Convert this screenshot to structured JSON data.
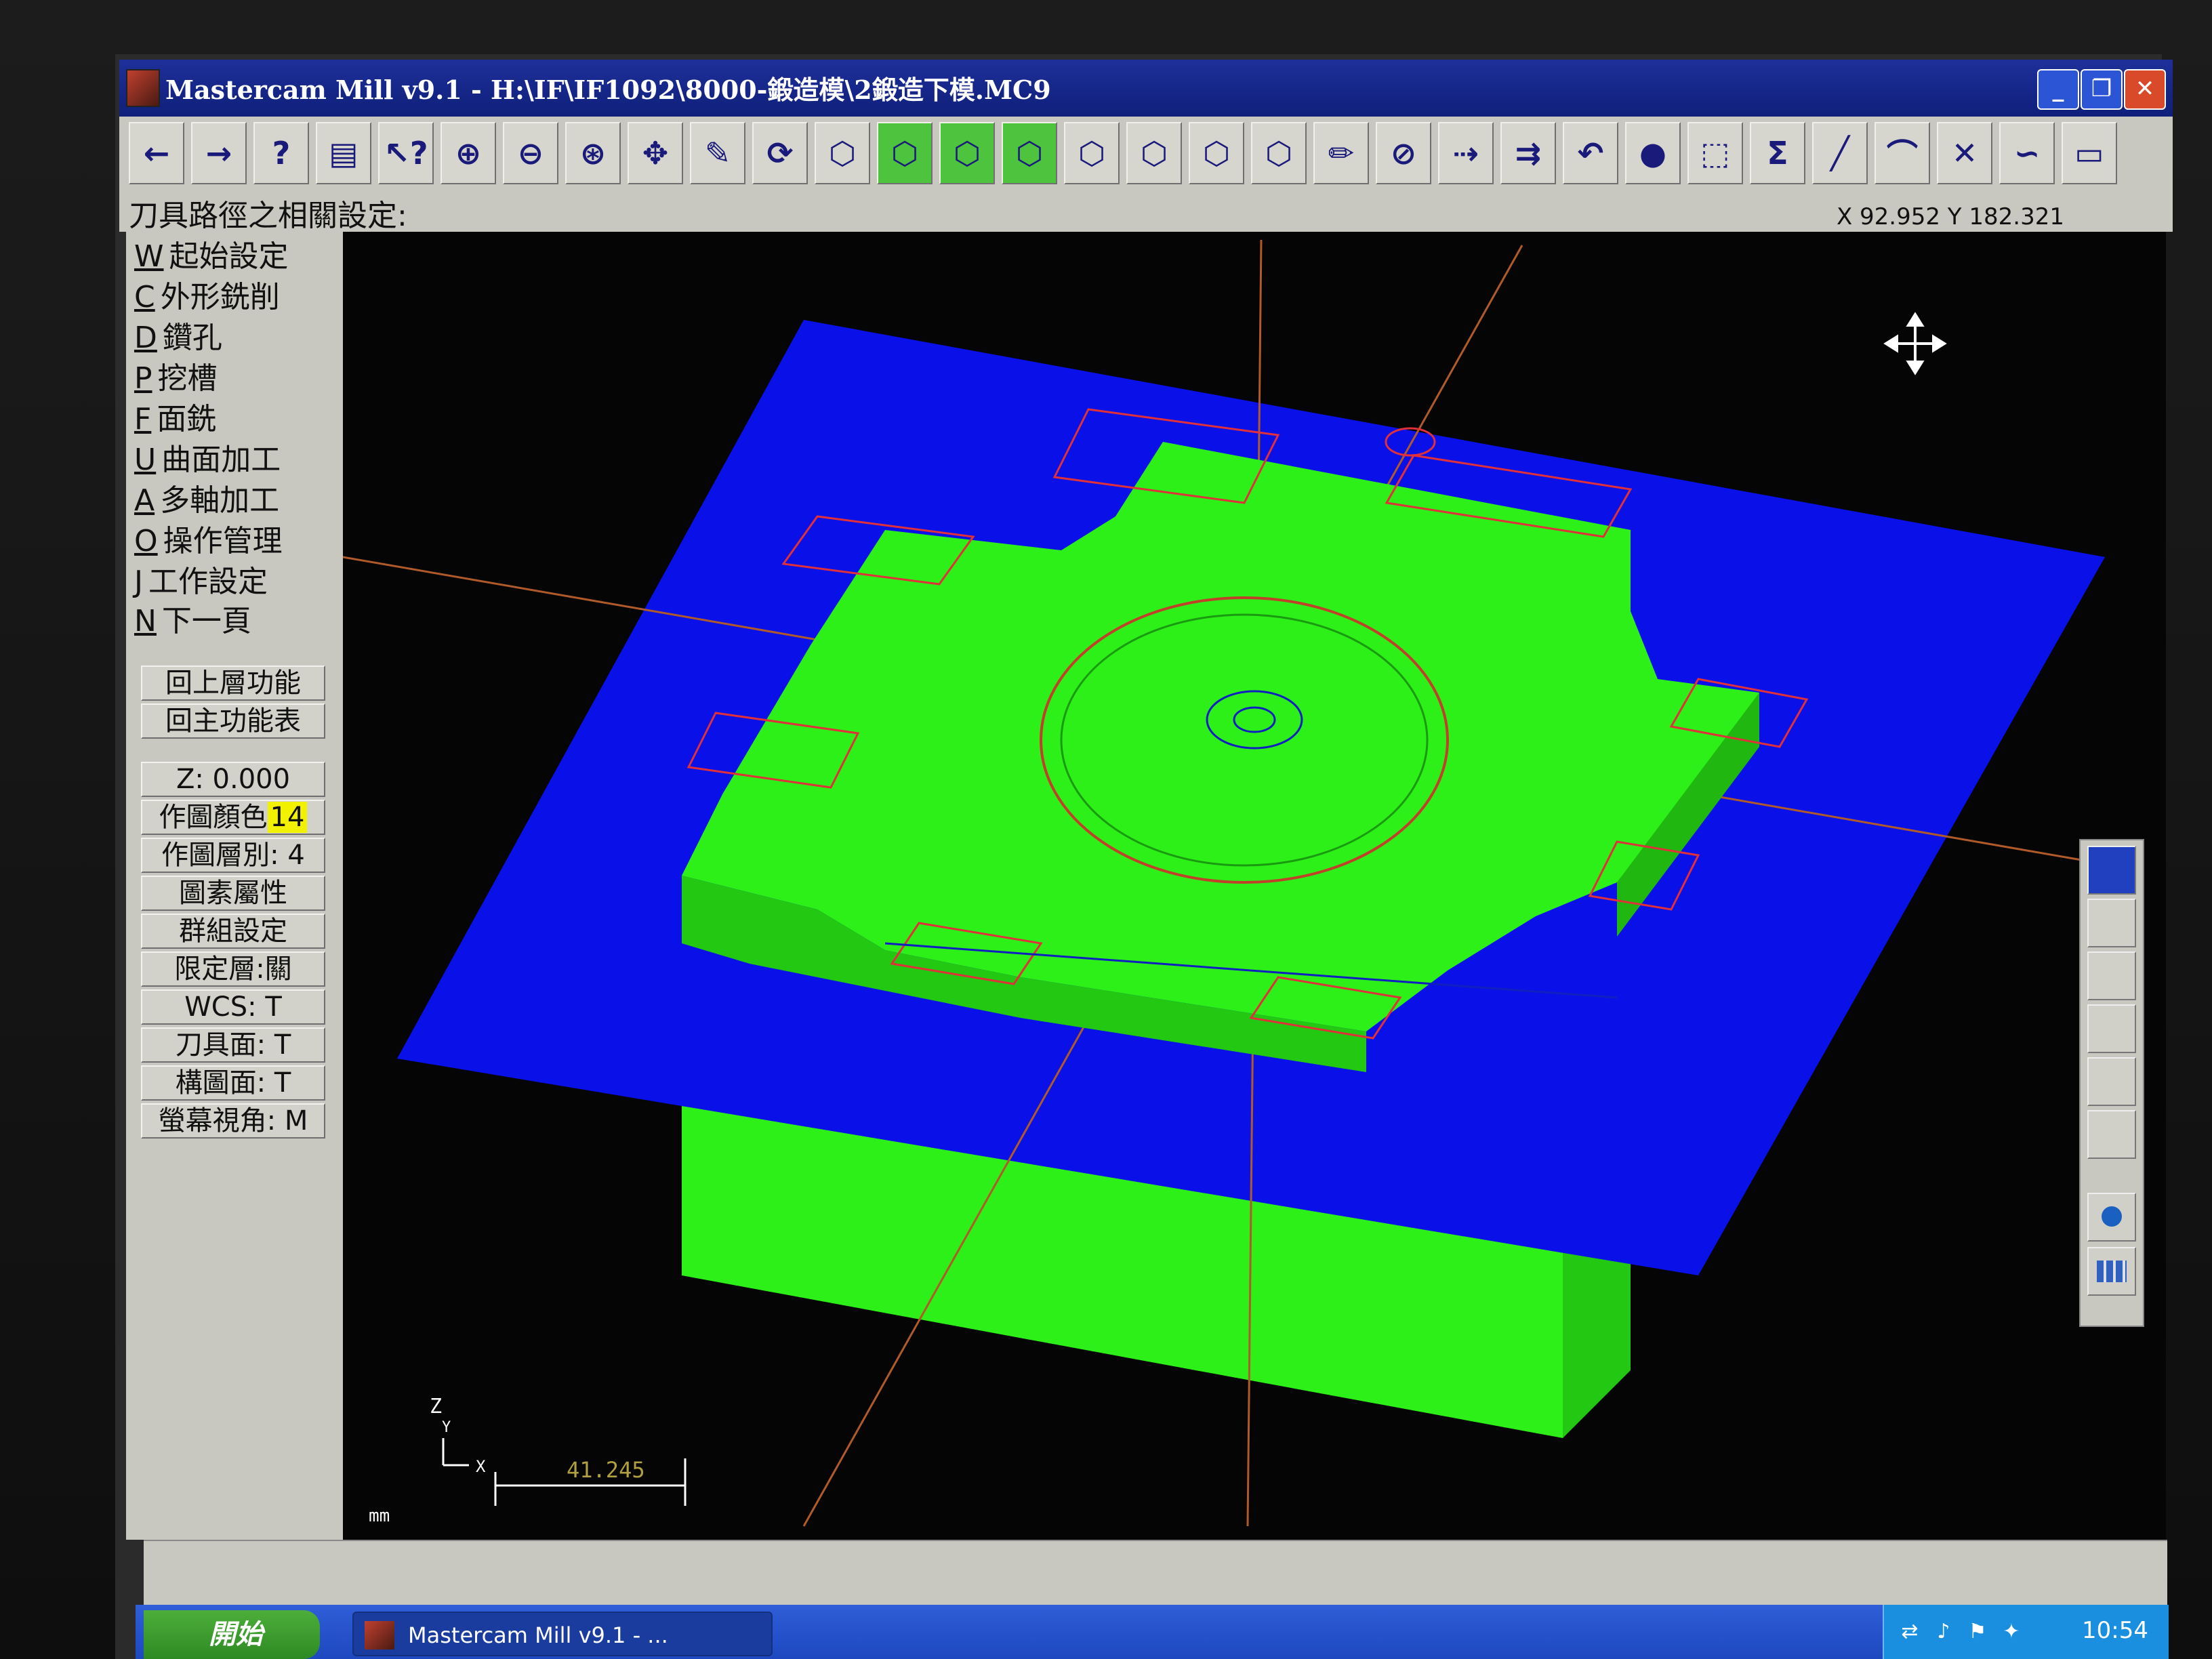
{
  "window": {
    "title": "Mastercam Mill v9.1 - H:\\IF\\IF1092\\8000-鍛造模\\2鍛造下模.MC9",
    "minimize": "_",
    "maximize": "❐",
    "close": "✕"
  },
  "toolbar": {
    "buttons": [
      {
        "name": "back-arrow-icon",
        "glyph": "◆",
        "label": "←"
      },
      {
        "name": "forward-arrow-icon",
        "label": "→"
      },
      {
        "name": "help-icon",
        "label": "?"
      },
      {
        "name": "file-cabinet-icon",
        "label": "▤"
      },
      {
        "name": "analyze-icon",
        "label": "↖?"
      },
      {
        "name": "zoom-window-icon",
        "label": "⊕"
      },
      {
        "name": "zoom-out-icon",
        "label": "⊖"
      },
      {
        "name": "zoom-fit-icon",
        "label": "⊛"
      },
      {
        "name": "pan-icon",
        "label": "✥"
      },
      {
        "name": "screen-repaint-icon",
        "label": "✎"
      },
      {
        "name": "rotate-view-icon",
        "label": "⟳"
      },
      {
        "name": "view-cube-front-icon",
        "label": "⬡"
      },
      {
        "name": "view-cube-top-green-icon",
        "label": "⬡"
      },
      {
        "name": "view-cube-side-green-icon",
        "label": "⬡"
      },
      {
        "name": "view-cube-iso-green-icon",
        "label": "⬡"
      },
      {
        "name": "cplane-top-icon",
        "label": "⬡"
      },
      {
        "name": "cplane-front-icon",
        "label": "⬡"
      },
      {
        "name": "cplane-side-icon",
        "label": "⬡"
      },
      {
        "name": "cplane-3d-icon",
        "label": "⬡"
      },
      {
        "name": "pencil-icon",
        "label": "✏"
      },
      {
        "name": "no-edit-icon",
        "label": "⊘"
      },
      {
        "name": "move-entity-icon",
        "label": "⇢"
      },
      {
        "name": "copy-entity-icon",
        "label": "⇉"
      },
      {
        "name": "undo-icon",
        "label": "↶"
      },
      {
        "name": "shaded-sphere-icon",
        "label": "●"
      },
      {
        "name": "transform-icon",
        "label": "⬚"
      },
      {
        "name": "sum-icon",
        "label": "Σ"
      },
      {
        "name": "line-icon",
        "label": "╱"
      },
      {
        "name": "arc-icon",
        "label": "⌒"
      },
      {
        "name": "trim-icon",
        "label": "✕"
      },
      {
        "name": "spline-icon",
        "label": "∽"
      },
      {
        "name": "rectangle-icon",
        "label": "▭"
      }
    ]
  },
  "prompt": {
    "text": "刀具路徑之相關設定:",
    "coords": "X 92.952  Y 182.321"
  },
  "menu": {
    "items": [
      {
        "key": "W",
        "label": "起始設定"
      },
      {
        "key": "C",
        "label": "外形銑削"
      },
      {
        "key": "D",
        "label": "鑽孔"
      },
      {
        "key": "P",
        "label": "挖槽"
      },
      {
        "key": "F",
        "label": "面銑"
      },
      {
        "key": "U",
        "label": "曲面加工"
      },
      {
        "key": "A",
        "label": "多軸加工"
      },
      {
        "key": "O",
        "label": "操作管理"
      },
      {
        "key": "J",
        "label": "工作設定"
      },
      {
        "key": "N",
        "label": "下一頁"
      }
    ],
    "back_up": "回上層功能",
    "main_menu": "回主功能表",
    "z_depth": "Z:  0.000",
    "color_label": "作圖顏色",
    "color_value": "14",
    "level": "作圖層別: 4",
    "attributes": "圖素屬性",
    "groups": "群組設定",
    "mask": "限定層:關",
    "wcs": "WCS:  T",
    "tplane": "刀具面: T",
    "cplane": "構圖面: T",
    "gview": "螢幕視角: M"
  },
  "viewport": {
    "axis_z": "Z",
    "axis_y": "Y",
    "axis_x": "X",
    "scale_value": "41.245",
    "units": "mm",
    "colors": {
      "background": "#050505",
      "stock_plane": "#0a10e8",
      "part": "#2cf018",
      "part_dark": "#22c812",
      "axis_lines": "#b05a2a",
      "toolpath": "#e0303a"
    }
  },
  "taskbar": {
    "start": "開始",
    "app": "Mastercam Mill v9.1 - ...",
    "clock": "10:54"
  }
}
